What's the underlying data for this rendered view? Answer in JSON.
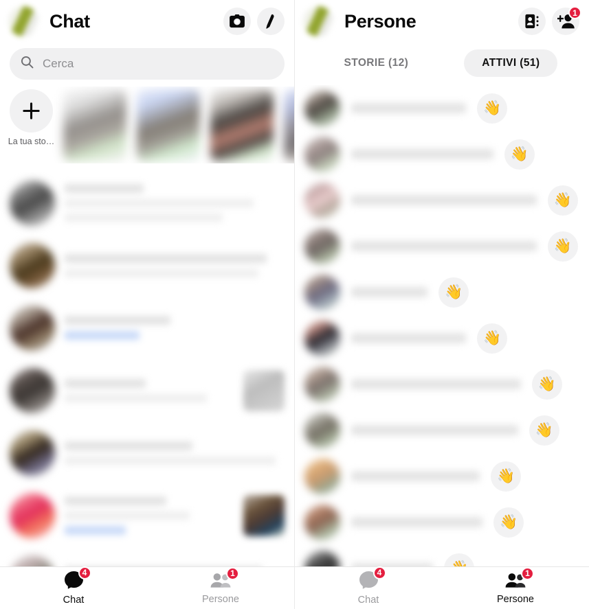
{
  "left_panel": {
    "header": {
      "avatar_name": "user-avatar",
      "title": "Chat",
      "actions": [
        {
          "name": "camera-icon",
          "label": "Fotocamera"
        },
        {
          "name": "compose-pencil-icon",
          "label": "Nuovo messaggio"
        }
      ]
    },
    "search": {
      "placeholder": "Cerca",
      "value": "",
      "icon": "search-icon"
    },
    "stories": {
      "add_story_label": "La tua sto…",
      "add_icon": "plus-icon",
      "thumbs": [
        {
          "name": "story-thumb-1"
        },
        {
          "name": "story-thumb-2"
        },
        {
          "name": "story-thumb-3"
        },
        {
          "name": "story-thumb-4"
        }
      ]
    },
    "chats": [
      {
        "name_redacted": true,
        "avatar": "av-a",
        "lines": 3,
        "has_thumb": false
      },
      {
        "name_redacted": true,
        "avatar": "av-b",
        "lines": 2,
        "has_thumb": false
      },
      {
        "name_redacted": true,
        "avatar": "av-c",
        "lines": 2,
        "has_thumb": false
      },
      {
        "name_redacted": true,
        "avatar": "av-d",
        "lines": 2,
        "has_thumb": true
      },
      {
        "name_redacted": true,
        "avatar": "av-e",
        "lines": 2,
        "has_thumb": false
      },
      {
        "name_redacted": true,
        "avatar": "av-f",
        "lines": 3,
        "has_thumb": true
      },
      {
        "name_redacted": true,
        "avatar": "av-g",
        "lines": 2,
        "has_thumb": false
      }
    ],
    "bottom_nav": [
      {
        "name": "chat",
        "label": "Chat",
        "badge": "4",
        "active": true,
        "icon": "chat-bubble-icon"
      },
      {
        "name": "persone",
        "label": "Persone",
        "badge": "1",
        "active": false,
        "icon": "people-icon"
      }
    ]
  },
  "right_panel": {
    "header": {
      "avatar_name": "user-avatar",
      "title": "Persone",
      "actions": [
        {
          "name": "contacts-book-icon",
          "label": "Contatti",
          "badge": ""
        },
        {
          "name": "add-person-icon",
          "label": "Aggiungi persona",
          "badge": "1"
        }
      ]
    },
    "tabs": [
      {
        "name": "tab-storie",
        "label": "STORIE (12)",
        "active": false
      },
      {
        "name": "tab-attivi",
        "label": "ATTIVI (51)",
        "active": true
      }
    ],
    "people": [
      {
        "avatar": "pv-1",
        "name_width": 42
      },
      {
        "avatar": "pv-2",
        "name_width": 52
      },
      {
        "avatar": "pv-3",
        "name_width": 83
      },
      {
        "avatar": "pv-4",
        "name_width": 80
      },
      {
        "avatar": "pv-5",
        "name_width": 28
      },
      {
        "avatar": "pv-6",
        "name_width": 42
      },
      {
        "avatar": "pv-7",
        "name_width": 62
      },
      {
        "avatar": "pv-8",
        "name_width": 61
      },
      {
        "avatar": "pv-9",
        "name_width": 47
      },
      {
        "avatar": "pv-10",
        "name_width": 48
      },
      {
        "avatar": "pv-11",
        "name_width": 30
      }
    ],
    "wave_button": {
      "name": "wave-hand-button",
      "glyph": "👋"
    },
    "bottom_nav": [
      {
        "name": "chat",
        "label": "Chat",
        "badge": "4",
        "active": false,
        "icon": "chat-bubble-icon"
      },
      {
        "name": "persone",
        "label": "Persone",
        "badge": "1",
        "active": true,
        "icon": "people-icon"
      }
    ]
  },
  "colors": {
    "badge_red": "#e41e3f",
    "accent_olive": "#8a9e1e",
    "surface": "#f1f1f2",
    "text_primary": "#0a0a0a",
    "text_muted": "#9a9a9d"
  }
}
